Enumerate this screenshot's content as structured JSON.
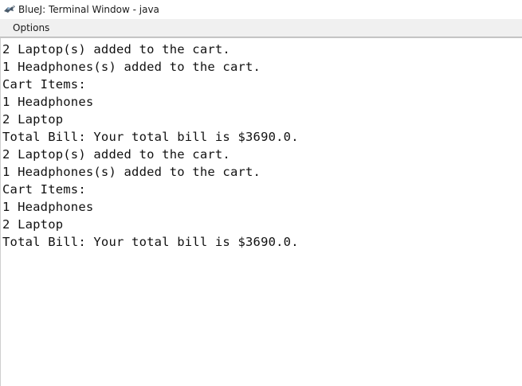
{
  "window": {
    "title": "BlueJ: Terminal Window - java",
    "icon": "bluej-bird-icon"
  },
  "menu": {
    "items": [
      {
        "label": "Options"
      }
    ]
  },
  "terminal": {
    "lines": [
      "2 Laptop(s) added to the cart.",
      "1 Headphones(s) added to the cart.",
      "Cart Items:",
      "1 Headphones",
      "2 Laptop",
      "Total Bill: Your total bill is $3690.0.",
      "2 Laptop(s) added to the cart.",
      "1 Headphones(s) added to the cart.",
      "Cart Items:",
      "1 Headphones",
      "2 Laptop",
      "Total Bill: Your total bill is $3690.0."
    ]
  }
}
